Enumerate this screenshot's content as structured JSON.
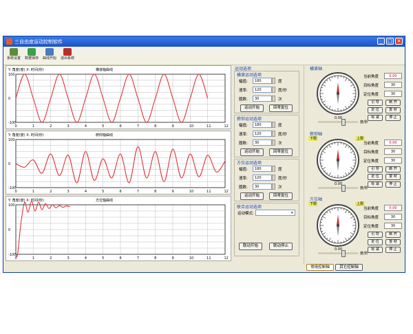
{
  "window": {
    "title": "三自由度运动控制软件",
    "controls": {
      "minimize": "_",
      "maximize": "□",
      "close": "✕"
    }
  },
  "toolbar": {
    "buttons": [
      {
        "label": "系统设置",
        "color": "#5a8f3a"
      },
      {
        "label": "数据保存",
        "color": "#3aa04a"
      },
      {
        "label": "曲线开始",
        "color": "#4a7abf"
      },
      {
        "label": "退出系统",
        "color": "#b5302a"
      }
    ]
  },
  "charts": [
    {
      "axis_label": "Y: 角度(度) X: 时间(秒)",
      "title": "横滚轴曲线",
      "y_ticks": [
        "100",
        "0",
        "-100"
      ],
      "x_ticks": [
        "0",
        "1",
        "2",
        "3",
        "4",
        "5",
        "6",
        "7",
        "8",
        "9",
        "10",
        "11",
        "12"
      ]
    },
    {
      "axis_label": "Y: 角度(度) X: 时间(秒)",
      "title": "俯仰轴曲线",
      "y_ticks": [
        "100",
        "0",
        "-100"
      ],
      "x_ticks": [
        "0",
        "1",
        "2",
        "3",
        "4",
        "5",
        "6",
        "7",
        "8",
        "9",
        "10",
        "11",
        "12"
      ]
    },
    {
      "axis_label": "Y: 角度(度) X: 时间(秒)",
      "title": "方位轴曲线",
      "y_ticks": [
        "100",
        "0",
        "-100"
      ],
      "x_ticks": [
        "0",
        "1",
        "2",
        "3",
        "4",
        "5",
        "6",
        "7",
        "8",
        "9",
        "10",
        "11",
        "12"
      ]
    }
  ],
  "chart_data": [
    {
      "type": "line",
      "title": "横滚轴曲线",
      "xlabel": "时间(秒)",
      "ylabel": "角度(度)",
      "xlim": [
        0,
        12
      ],
      "ylim": [
        -100,
        100
      ],
      "series": [
        {
          "x": [
            0,
            0.5,
            1,
            1.5,
            2,
            2.5,
            3,
            3.5,
            4,
            4.5,
            5,
            5.5,
            6,
            6.5,
            7,
            7.5,
            8,
            8.5,
            9,
            9.5,
            10,
            10.5,
            11
          ],
          "values": [
            0,
            100,
            0,
            -100,
            0,
            100,
            0,
            -100,
            0,
            100,
            0,
            -100,
            0,
            100,
            0,
            -100,
            0,
            100,
            0,
            -100,
            0,
            100,
            0
          ]
        }
      ]
    },
    {
      "type": "line",
      "title": "俯仰轴曲线",
      "xlabel": "时间(秒)",
      "ylabel": "角度(度)",
      "xlim": [
        0,
        12
      ],
      "ylim": [
        -100,
        100
      ],
      "series": [
        {
          "x": [
            0,
            0.5,
            1,
            1.5,
            2,
            2.5,
            3,
            3.5,
            4,
            4.5,
            5,
            5.5,
            6,
            6.5,
            7,
            7.5,
            8,
            8.5,
            9,
            9.5,
            10,
            10.5,
            11,
            11.5,
            12
          ],
          "values": [
            0,
            -15,
            15,
            -40,
            40,
            -50,
            35,
            -80,
            50,
            -70,
            20,
            -60,
            40,
            -80,
            70,
            -60,
            50,
            -75,
            60,
            -60,
            40,
            -55,
            35,
            -35,
            10
          ]
        }
      ]
    },
    {
      "type": "line",
      "title": "方位轴曲线",
      "xlabel": "时间(秒)",
      "ylabel": "角度(度)",
      "xlim": [
        0,
        12
      ],
      "ylim": [
        -100,
        100
      ],
      "series": [
        {
          "x": [
            0,
            0.1,
            0.3,
            0.5,
            0.7,
            0.9,
            1.1,
            1.3,
            1.5,
            1.7,
            1.9,
            2.1,
            2.3,
            2.5,
            2.7,
            2.9,
            3.1
          ],
          "values": [
            -100,
            -100,
            30,
            110,
            70,
            115,
            75,
            110,
            80,
            105,
            85,
            100,
            88,
            97,
            90,
            95,
            92
          ]
        }
      ]
    }
  ],
  "control_panel": {
    "motion_title": "运动选项",
    "groups": [
      {
        "title": "横滚运动选项",
        "fields": [
          {
            "label": "幅值:",
            "value": "180",
            "unit": "度"
          },
          {
            "label": "速率:",
            "value": "120",
            "unit": "度/秒"
          },
          {
            "label": "圈数:",
            "value": "30",
            "unit": "次"
          }
        ],
        "buttons": [
          "运动开始",
          "回零复位"
        ]
      },
      {
        "title": "俯仰运动选项",
        "fields": [
          {
            "label": "幅值:",
            "value": "180",
            "unit": "度"
          },
          {
            "label": "速率:",
            "value": "120",
            "unit": "度/秒"
          },
          {
            "label": "圈数:",
            "value": "30",
            "unit": "次"
          }
        ],
        "buttons": [
          "运动开始",
          "回零复位"
        ]
      },
      {
        "title": "方位运动选项",
        "fields": [
          {
            "label": "幅值:",
            "value": "180",
            "unit": "度"
          },
          {
            "label": "速率:",
            "value": "120",
            "unit": "度/秒"
          },
          {
            "label": "圈数:",
            "value": "30",
            "unit": "次"
          }
        ],
        "buttons": [
          "运动开始",
          "回零复位"
        ]
      },
      {
        "title": "联合运动选项",
        "fields": [
          {
            "label": "运动模式:",
            "value": "",
            "unit": ""
          }
        ],
        "buttons": [
          "联动开始",
          "联动停止"
        ]
      }
    ]
  },
  "axes": [
    {
      "title": "横滚轴",
      "limit_left": "",
      "limit_right": "",
      "dial_value": "0.00",
      "unit": "度/秒",
      "readouts": [
        {
          "label": "当前角度",
          "value": "0.00"
        },
        {
          "label": "目标角度",
          "value": "30"
        },
        {
          "label": "定位角度",
          "value": "30"
        }
      ],
      "buttons": [
        "引 导",
        "断 开",
        "定 位",
        "复 材",
        "标 减",
        "停 止"
      ]
    },
    {
      "title": "俯仰轴",
      "limit_left": "下限",
      "limit_right": "上限",
      "dial_value": "0.00",
      "unit": "度/秒",
      "readouts": [
        {
          "label": "当前角度",
          "value": "0.00"
        },
        {
          "label": "目标角度",
          "value": "30"
        },
        {
          "label": "定位角度",
          "value": "30"
        }
      ],
      "buttons": [
        "引 导",
        "断 开",
        "定 位",
        "复 材",
        "标 减",
        "停 止"
      ]
    },
    {
      "title": "方位轴",
      "limit_left": "下限",
      "limit_right": "上限",
      "dial_value": "0.00",
      "unit": "度/秒",
      "readouts": [
        {
          "label": "当前角度",
          "value": "0.00"
        },
        {
          "label": "目标角度",
          "value": "30"
        },
        {
          "label": "定位角度",
          "value": "30"
        }
      ],
      "buttons": [
        "引 导",
        "断 开",
        "定 位",
        "复 材",
        "标 减",
        "停 止"
      ]
    }
  ],
  "bottom_tabs": [
    "常用控制轴",
    "其它控制轴"
  ],
  "colors": {
    "curve": "#e0202a",
    "titlebar": "#1a52c8",
    "accent_yellow": "#e9e96a"
  }
}
